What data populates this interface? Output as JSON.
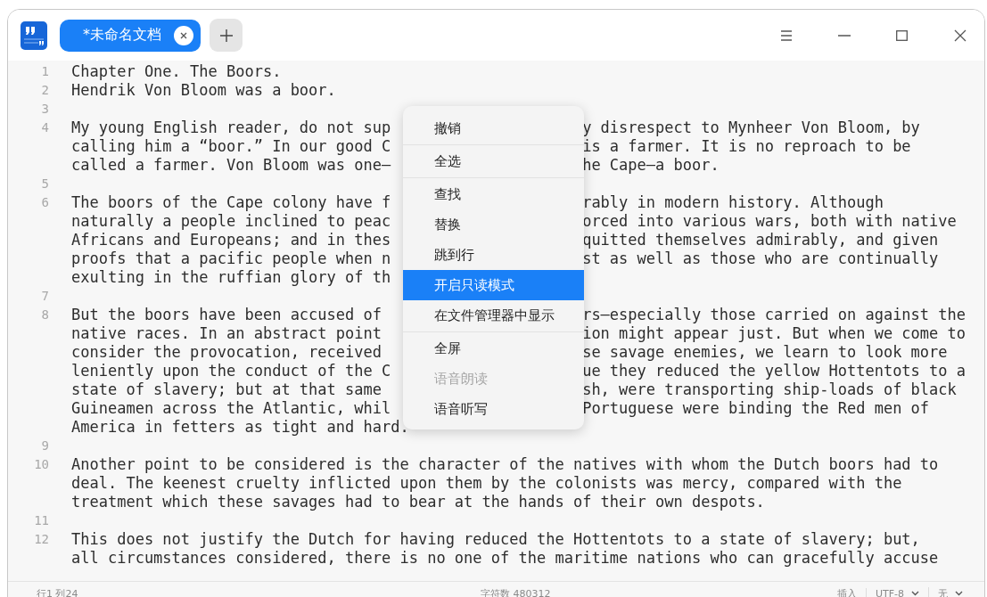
{
  "tabs": [
    {
      "label": "*未命名文档",
      "selected": true
    }
  ],
  "editor": {
    "lines": [
      {
        "number": "1",
        "rows": [
          {
            "left": "Chapter One. The Boors."
          }
        ]
      },
      {
        "number": "2",
        "rows": [
          {
            "left": "Hendrik Von Bloom was a boor."
          }
        ]
      },
      {
        "number": "3"
      },
      {
        "number": "4",
        "rows": [
          {
            "left": "My young English reader, do not sup",
            "right": "y disrespect to Mynheer Von Bloom, by"
          },
          {
            "left": "calling him a “boor.” In our good C",
            "right": "is a farmer. It is no reproach to be"
          },
          {
            "left": "called a farmer. Von Bloom was one—",
            "right": "he Cape—a boor."
          }
        ]
      },
      {
        "number": "5"
      },
      {
        "number": "6",
        "rows": [
          {
            "left": "The boors of the Cape colony have f",
            "right": "rably in modern history. Although"
          },
          {
            "left": "naturally a people inclined to peac",
            "right": "orced into various wars, both with native"
          },
          {
            "left": "Africans and Europeans; and in thes",
            "right": "quitted themselves admirably, and given"
          },
          {
            "left": "proofs that a pacific people when n",
            "right": "st as well as those who are continually"
          },
          {
            "left": "exulting in the ruffian glory of th"
          }
        ]
      },
      {
        "number": "7"
      },
      {
        "number": "8",
        "rows": [
          {
            "left": "But the boors have been accused of",
            "right": "rs—especially those carried on against the"
          },
          {
            "left": "native races. In an abstract point",
            "right": "ion might appear just. But when we come to"
          },
          {
            "left": "consider the provocation, received",
            "right": "se savage enemies, we learn to look more"
          },
          {
            "left": "leniently upon the conduct of the C",
            "right": "ue they reduced the yellow Hottentots to a"
          },
          {
            "left": "state of slavery; but at that same",
            "right": "sh, were transporting ship-loads of black"
          },
          {
            "left": "Guineamen across the Atlantic, whil",
            "right": "Portuguese were binding the Red men of"
          },
          {
            "left": "America in fetters as tight and hard."
          }
        ]
      },
      {
        "number": "9"
      },
      {
        "number": "10",
        "rows": [
          {
            "left": "Another point to be considered is the character of the natives with whom the Dutch boors had to"
          },
          {
            "left": "deal. The keenest cruelty inflicted upon them by the colonists was mercy, compared with the"
          },
          {
            "left": "treatment which these savages had to bear at the hands of their own despots."
          }
        ]
      },
      {
        "number": "11"
      },
      {
        "number": "12",
        "rows": [
          {
            "left": "This does not justify the Dutch for having reduced the Hottentots to a state of slavery; but,"
          },
          {
            "left": "all circumstances considered, there is no one of the maritime nations who can gracefully accuse"
          }
        ]
      }
    ]
  },
  "context_menu": {
    "groups": [
      [
        {
          "label": "撤销",
          "selected": false,
          "disabled": false
        }
      ],
      [
        {
          "label": "全选",
          "selected": false,
          "disabled": false
        }
      ],
      [
        {
          "label": "查找",
          "selected": false,
          "disabled": false
        },
        {
          "label": "替换",
          "selected": false,
          "disabled": false
        },
        {
          "label": "跳到行",
          "selected": false,
          "disabled": false
        },
        {
          "label": "开启只读模式",
          "selected": true,
          "disabled": false
        },
        {
          "label": "在文件管理器中显示",
          "selected": false,
          "disabled": false
        }
      ],
      [
        {
          "label": "全屏",
          "selected": false,
          "disabled": false
        },
        {
          "label": "语音朗读",
          "selected": false,
          "disabled": true
        },
        {
          "label": "语音听写",
          "selected": false,
          "disabled": false
        }
      ]
    ]
  },
  "status_bar": {
    "position": "行1 列24",
    "char_count": "字符数 480312",
    "mode": "插入",
    "encoding": "UTF-8",
    "highlight": "无"
  }
}
